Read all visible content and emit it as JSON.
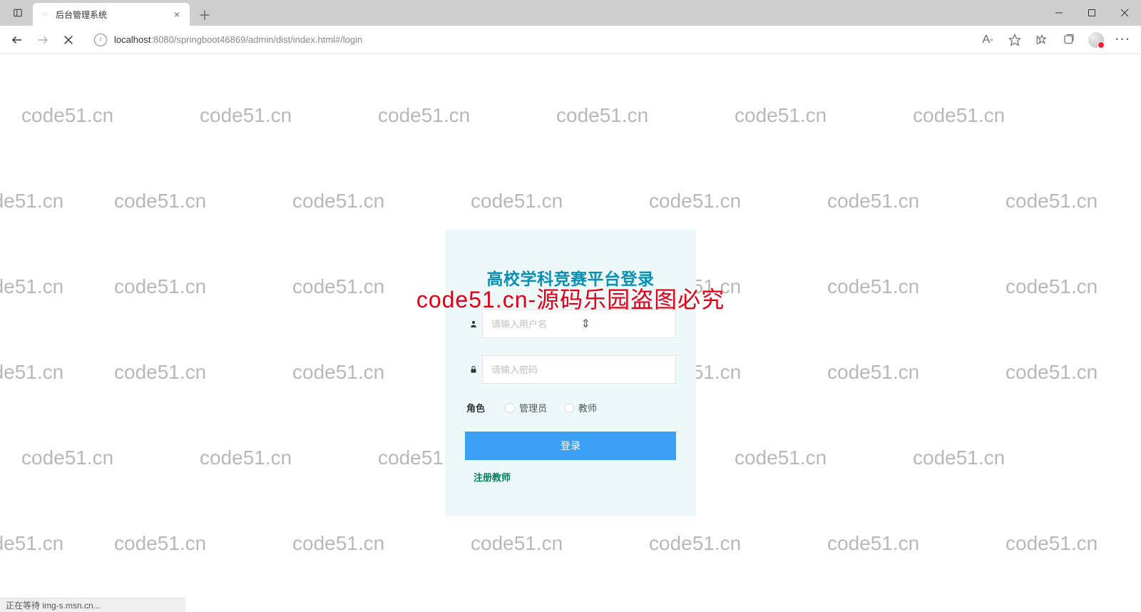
{
  "browser": {
    "tab_title": "后台管理系统",
    "url_host": "localhost",
    "url_port_path": ":8080/springboot46869/admin/dist/index.html#/login",
    "status_text": "正在等待 img-s.msn.cn..."
  },
  "watermark_text": "code51.cn",
  "red_overlay": "code51.cn-源码乐园盗图必究",
  "login": {
    "title": "高校学科竞赛平台登录",
    "username_placeholder": "请输入用户名",
    "password_placeholder": "请输入密码",
    "role_label": "角色",
    "role_options": [
      "管理员",
      "教师"
    ],
    "login_button": "登录",
    "register_link": "注册教师"
  }
}
